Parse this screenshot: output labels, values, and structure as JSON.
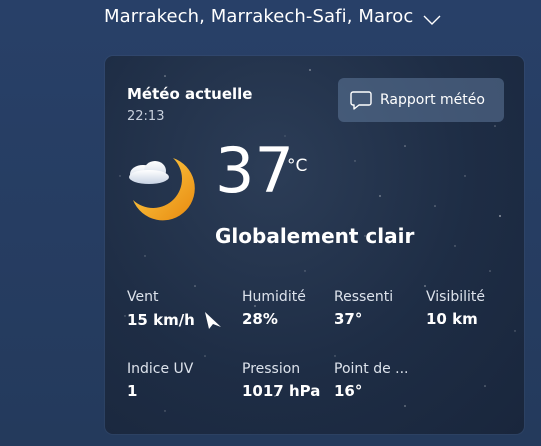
{
  "location": {
    "name": "Marrakech, Marrakech-Safi, Maroc",
    "dropdown_icon": "chevron-down-icon"
  },
  "card": {
    "title": "Météo actuelle",
    "time": "22:13",
    "report_button": {
      "label": "Rapport météo",
      "icon": "message-icon"
    },
    "temperature": "37",
    "unit": "°C",
    "condition": "Globalement clair",
    "condition_icon": "cloud-moon-icon",
    "stats": [
      {
        "label": "Vent",
        "value": "15 km/h",
        "icon": "wind-direction-icon"
      },
      {
        "label": "Humidité",
        "value": "28%"
      },
      {
        "label": "Ressenti",
        "value": "37°"
      },
      {
        "label": "Visibilité",
        "value": "10 km"
      },
      {
        "label": "Indice UV",
        "value": "1"
      },
      {
        "label": "Pression",
        "value": "1017 hPa"
      },
      {
        "label": "Point de ...",
        "value": "16°"
      }
    ]
  },
  "colors": {
    "background": "#263c5e",
    "card": "#1e2d45",
    "button": "#5f789b",
    "moon": "#f0a51e"
  }
}
